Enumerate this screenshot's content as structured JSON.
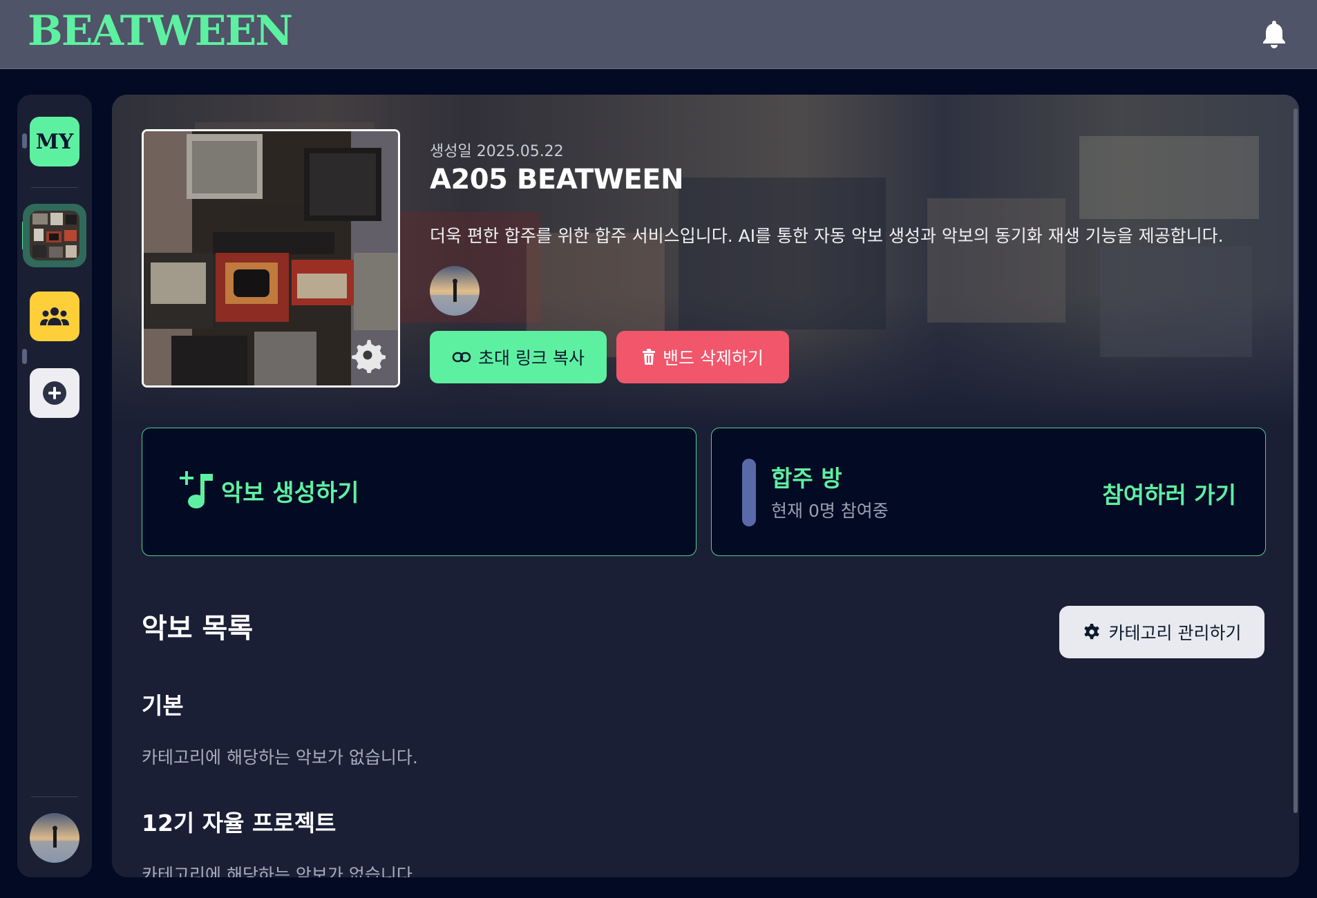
{
  "app": {
    "logo": "BEATWEEN",
    "notification_icon": "bell-icon"
  },
  "sidebar": {
    "my_label": "MY",
    "items": [
      {
        "name": "band",
        "icon": "band-thumbnail"
      },
      {
        "name": "group",
        "icon": "group-icon"
      },
      {
        "name": "add",
        "icon": "plus-circle-icon"
      }
    ]
  },
  "band": {
    "created_label": "생성일 2025.05.22",
    "name": "A205 BEATWEEN",
    "description": "더욱 편한 합주를 위한 합주 서비스입니다. AI를 통한 자동 악보 생성과 악보의 동기화 재생 기능을 제공합니다.",
    "invite_button": "초대 링크 복사",
    "delete_button": "밴드 삭제하기"
  },
  "cards": {
    "score_create": "악보 생성하기",
    "room_title": "합주 방",
    "room_status": "현재 0명 참여중",
    "room_join": "참여하러 가기"
  },
  "scores": {
    "title": "악보 목록",
    "manage_button": "카테고리 관리하기",
    "categories": [
      {
        "name": "기본",
        "empty_text": "카테고리에 해당하는 악보가 없습니다."
      },
      {
        "name": "12기 자율 프로젝트",
        "empty_text": "카테고리에 해당하는 악보가 없습니다."
      }
    ]
  },
  "colors": {
    "accent": "#5ef0a1",
    "danger": "#f2566b",
    "bg": "#030a24",
    "panel": "#1b1f35",
    "topbar": "#4f5468",
    "yellow": "#ffcf3a"
  }
}
